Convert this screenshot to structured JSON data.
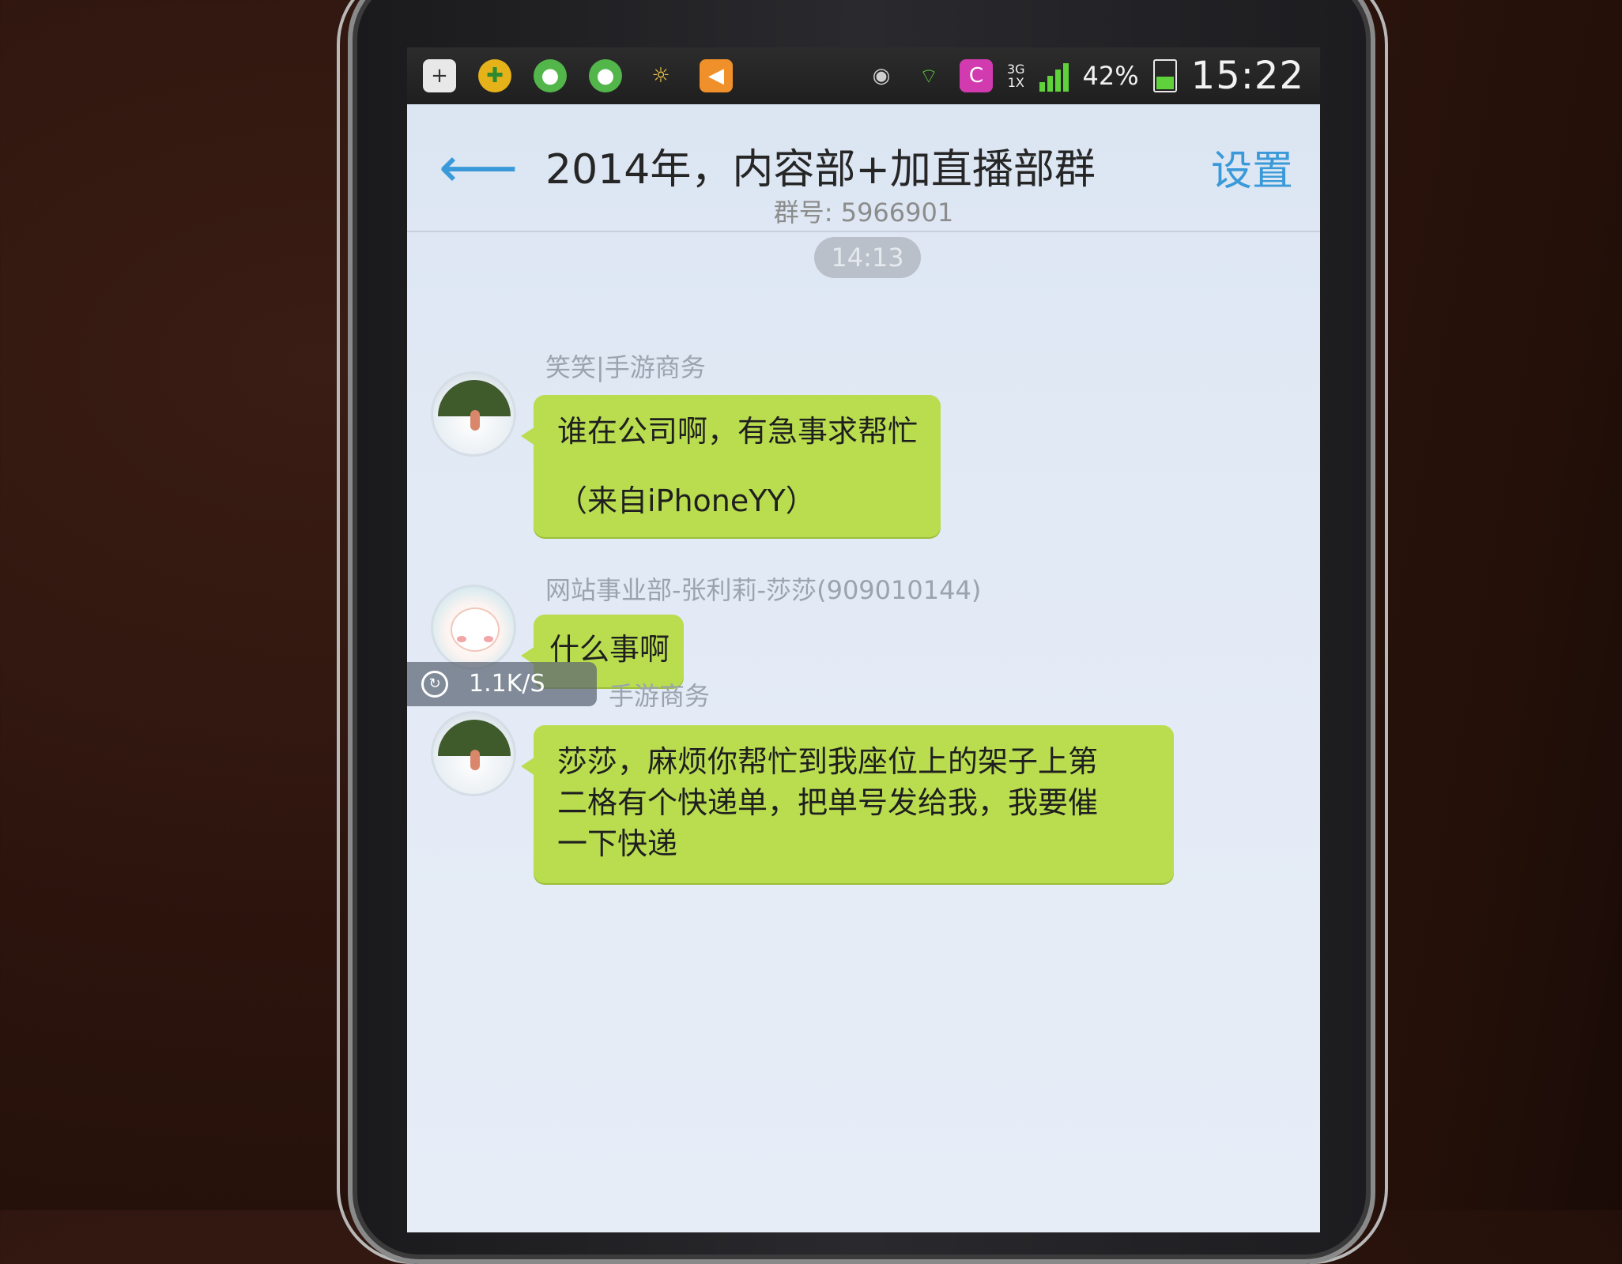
{
  "status_bar": {
    "battery": "42%",
    "time": "15:22",
    "network_top": "3G",
    "network_bottom": "1X",
    "notification_icons": [
      "add-icon",
      "plus-circle-icon",
      "wechat-icon",
      "wechat-icon",
      "weather-icon",
      "volume-icon"
    ],
    "system_icons": [
      "eye-icon",
      "wifi-icon",
      "c-app-icon",
      "signal-icon",
      "battery-icon"
    ]
  },
  "header": {
    "title": "2014年，内容部+加直播部群",
    "settings_label": "设置",
    "group_id": "群号: 5966901"
  },
  "chat": {
    "timestamp": "14:13",
    "messages": [
      {
        "sender": "笑笑|手游商务",
        "lines": [
          "谁在公司啊，有急事求帮忙",
          "（来自iPhoneYY）"
        ]
      },
      {
        "sender": "网站事业部-张利莉-莎莎(909010144)",
        "lines": [
          "什么事啊"
        ]
      },
      {
        "sender": "手游商务",
        "lines": [
          "莎莎，麻烦你帮忙到我座位上的架子上第",
          "二格有个快递单，把单号发给我，我要催",
          "一下快递"
        ]
      }
    ],
    "speed_overlay": "1.1K/S"
  },
  "colors": {
    "bubble": "#b9dd4f",
    "accent": "#3a9ad9",
    "status_bar": "#1f1f1f"
  }
}
